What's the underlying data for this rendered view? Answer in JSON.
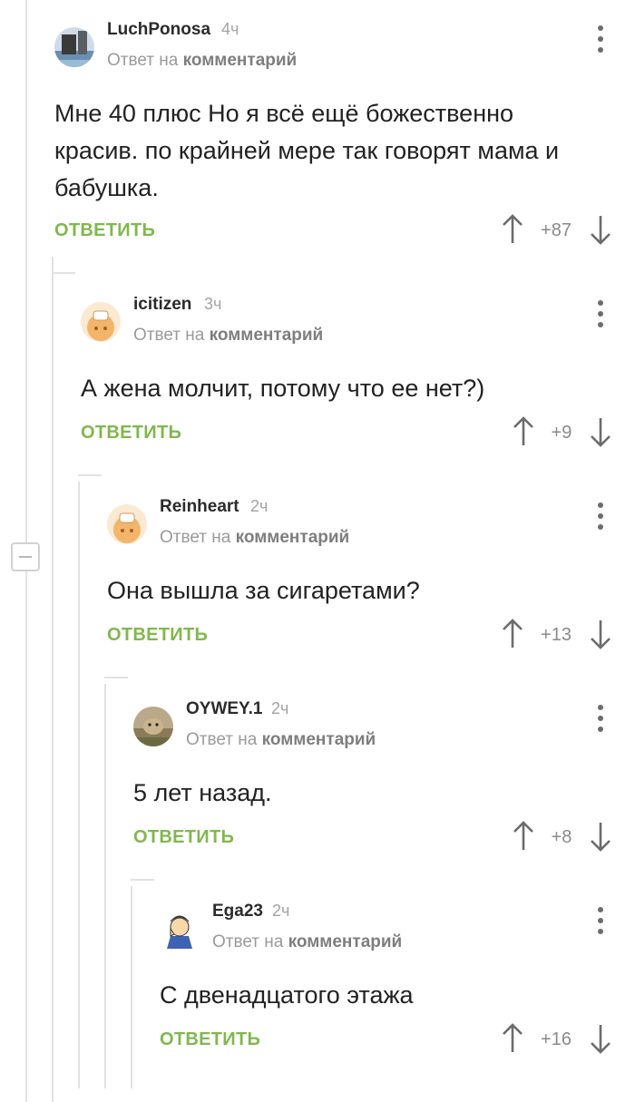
{
  "comments": [
    {
      "username": "LuchPonosa",
      "time": "4ч",
      "reply_prefix": "Ответ на",
      "reply_link": "комментарий",
      "text_lines": [
        "Мне 40 плюс Но я всё ещё божественно",
        "красив. по крайней мере так говорят мама и",
        "бабушка."
      ],
      "reply_label": "ОТВЕТИТЬ",
      "rating": "+87",
      "avatar": "photo-avatar"
    },
    {
      "username": "icitizen",
      "time": "3ч",
      "reply_prefix": "Ответ на",
      "reply_link": "комментарий",
      "text_lines": [
        "А жена молчит, потому что ее нет?)"
      ],
      "reply_label": "ОТВЕТИТЬ",
      "rating": "+9",
      "avatar": "default-avatar"
    },
    {
      "username": "Reinheart",
      "time": "2ч",
      "reply_prefix": "Ответ на",
      "reply_link": "комментарий",
      "text_lines": [
        "Она вышла за сигаретами?"
      ],
      "reply_label": "ОТВЕТИТЬ",
      "rating": "+13",
      "avatar": "default-avatar"
    },
    {
      "username": "OYWEY.1",
      "time": "2ч",
      "reply_prefix": "Ответ на",
      "reply_link": "комментарий",
      "text_lines": [
        "5 лет назад."
      ],
      "reply_label": "ОТВЕТИТЬ",
      "rating": "+8",
      "avatar": "photo-avatar"
    },
    {
      "username": "Ega23",
      "time": "2ч",
      "reply_prefix": "Ответ на",
      "reply_link": "комментарий",
      "text_lines": [
        "С двенадцатого этажа"
      ],
      "reply_label": "ОТВЕТИТЬ",
      "rating": "+16",
      "avatar": "cartoon-avatar"
    }
  ],
  "icons": {
    "upvote": "arrow-up-icon",
    "downvote": "arrow-down-icon",
    "menu": "more-vertical-icon",
    "collapse": "minus-icon"
  },
  "colors": {
    "reply_accent": "#80b84e",
    "thread_line": "#e2e2e2"
  }
}
